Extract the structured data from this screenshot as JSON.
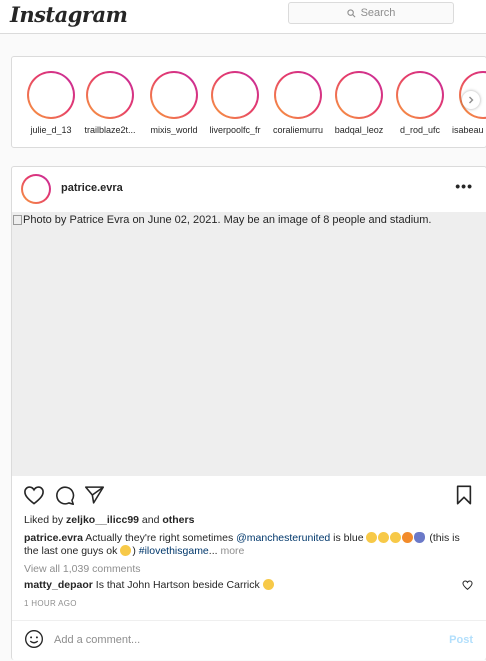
{
  "header": {
    "logo": "Instagram",
    "search_placeholder": "Search"
  },
  "stories": [
    {
      "name": "julie_d_13"
    },
    {
      "name": "trailblaze2t..."
    },
    {
      "name": "mixis_world"
    },
    {
      "name": "liverpoolfc_fr"
    },
    {
      "name": "coraliemurru"
    },
    {
      "name": "badqal_leoz"
    },
    {
      "name": "d_rod_ufc"
    },
    {
      "name": "isabeau"
    }
  ],
  "post": {
    "username": "patrice.evra",
    "image_alt": "Photo by Patrice Evra on June 02, 2021. May be an image of 8 people and stadium.",
    "likes_prefix": "Liked by ",
    "likes_user": "zeljko__ilicc99",
    "likes_suffix": " and ",
    "likes_others": "others",
    "caption_user": "patrice.evra",
    "caption_text_1": " Actually they're right sometimes ",
    "caption_mention": "@manchesterunited",
    "caption_text_2": " is blue ",
    "caption_text_3": " (this is the last one guys ok ",
    "caption_text_4": ") ",
    "caption_hashtag": "#ilovethisgame",
    "caption_ellipsis": "... ",
    "caption_more": "more",
    "view_all_comments": "View all 1,039 comments",
    "comment_user": "matty_depaor",
    "comment_text": " Is that John Hartson beside Carrick ",
    "time": "1 HOUR AGO",
    "add_comment_placeholder": "Add a comment...",
    "post_button": "Post"
  },
  "colors": {
    "story_ring_start": "#f9a13b",
    "story_ring_end": "#c32aa3",
    "link": "#00376b",
    "post_button_disabled": "#b2dffc"
  },
  "icons": [
    "search-icon",
    "chevron-right-icon",
    "more-icon",
    "heart-icon",
    "comment-icon",
    "share-icon",
    "bookmark-icon",
    "smiley-icon"
  ]
}
